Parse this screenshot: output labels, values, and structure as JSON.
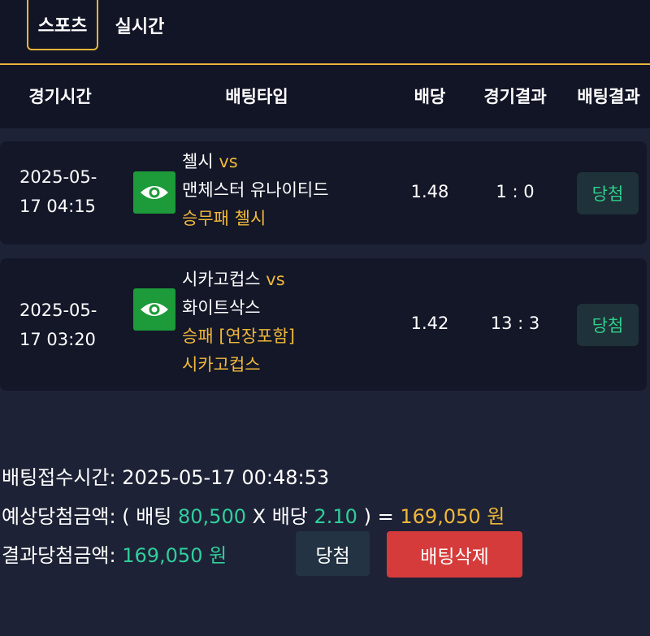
{
  "tabs": [
    {
      "label": "스포츠",
      "active": true
    },
    {
      "label": "실시간",
      "active": false
    }
  ],
  "table_headers": [
    "경기시간",
    "배팅타입",
    "배당",
    "경기결과",
    "배팅결과"
  ],
  "bets": [
    {
      "time_line1": "2025-05-",
      "time_line2": "17 04:15",
      "home": "첼시",
      "vs": "vs",
      "away": "맨체스터 유나이티드",
      "pick_line1": "승무패 첼시",
      "pick_line2": "",
      "odds": "1.48",
      "score": "1 : 0",
      "result": "당첨"
    },
    {
      "time_line1": "2025-05-",
      "time_line2": "17 03:20",
      "home": "시카고컵스",
      "vs": "vs",
      "away": "화이트삭스",
      "pick_line1": "승패 [연장포함]",
      "pick_line2": "시카고컵스",
      "odds": "1.42",
      "score": "13 : 3",
      "result": "당첨"
    }
  ],
  "summary": {
    "received_label": "배팅접수시간:",
    "received_value": "2025-05-17 00:48:53",
    "expected_label": "예상당첨금액:",
    "expected_open": "( 배팅",
    "expected_stake": "80,500",
    "expected_x": "X 배당",
    "expected_odds": "2.10",
    "expected_close": ") =",
    "expected_amount": "169,050 원",
    "result_label": "결과당첨금액:",
    "result_amount": "169,050 원"
  },
  "buttons": {
    "win": "당첨",
    "delete": "배팅삭제"
  },
  "colors": {
    "accent_yellow": "#f0b83a",
    "win_teal": "#2fcf9c",
    "delete_red": "#d63b3b",
    "eye_green": "#1d9a3a"
  }
}
